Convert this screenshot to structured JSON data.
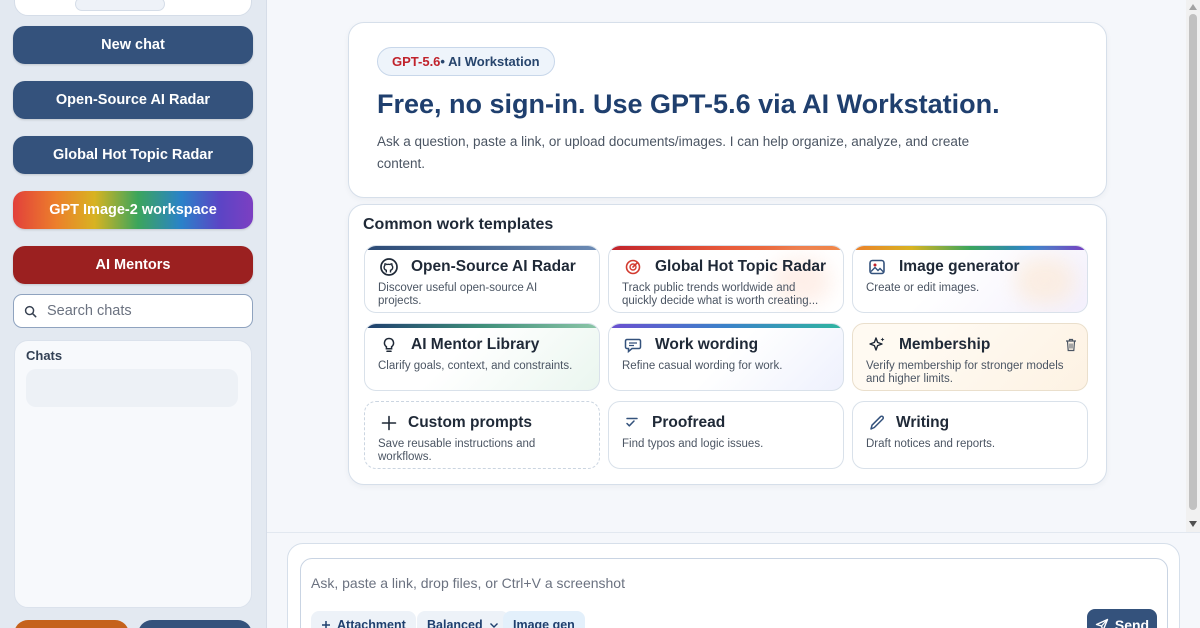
{
  "sidebar": {
    "buttons": {
      "new_chat": "New chat",
      "open_source_radar": "Open-Source AI Radar",
      "hot_topic_radar": "Global Hot Topic Radar",
      "image_workspace": "GPT Image-2 workspace",
      "ai_mentors": "AI Mentors"
    },
    "search": {
      "placeholder": "Search chats"
    },
    "chats": {
      "title": "Chats"
    }
  },
  "hero": {
    "badge_model": "GPT-5.6",
    "badge_rest": "• AI Workstation",
    "title": "Free, no sign-in. Use GPT-5.6 via AI Workstation.",
    "description": "Ask a question, paste a link, or upload documents/images. I can help organize, analyze, and create content."
  },
  "templates": {
    "title": "Common work templates",
    "cards": [
      {
        "title": "Open-Source AI Radar",
        "desc": "Discover useful open-source AI projects.",
        "icon": "github-icon",
        "accent": "#34527c"
      },
      {
        "title": "Global Hot Topic Radar",
        "desc": "Track public trends worldwide and quickly decide what is worth creating...",
        "icon": "radar-icon",
        "accent": "#e2403b"
      },
      {
        "title": "Image generator",
        "desc": "Create or edit images.",
        "icon": "image-icon",
        "accent": "rainbow"
      },
      {
        "title": "AI Mentor Library",
        "desc": "Clarify goals, context, and constraints.",
        "icon": "lightbulb-icon",
        "accent": "#2f7f6f"
      },
      {
        "title": "Work wording",
        "desc": "Refine casual wording for work.",
        "icon": "chat-bubble-icon",
        "accent": "#6b4fd0"
      },
      {
        "title": "Membership",
        "desc": "Verify membership for stronger models and higher limits.",
        "icon": "sparkle-icon",
        "accent": "none"
      },
      {
        "title": "Custom prompts",
        "desc": "Save reusable instructions and workflows.",
        "icon": "plus-icon",
        "accent": "none"
      },
      {
        "title": "Proofread",
        "desc": "Find typos and logic issues.",
        "icon": "check-list-icon",
        "accent": "none"
      },
      {
        "title": "Writing",
        "desc": "Draft notices and reports.",
        "icon": "pen-icon",
        "accent": "none"
      }
    ]
  },
  "composer": {
    "placeholder": "Ask, paste a link, drop files, or Ctrl+V a screenshot",
    "attachment_label": "Attachment",
    "mode_label": "Balanced",
    "image_gen_label": "Image gen",
    "send_label": "Send"
  },
  "colors": {
    "brand_navy": "#34527c",
    "mentor_red": "#9b2020",
    "model_red": "#c0222b"
  }
}
